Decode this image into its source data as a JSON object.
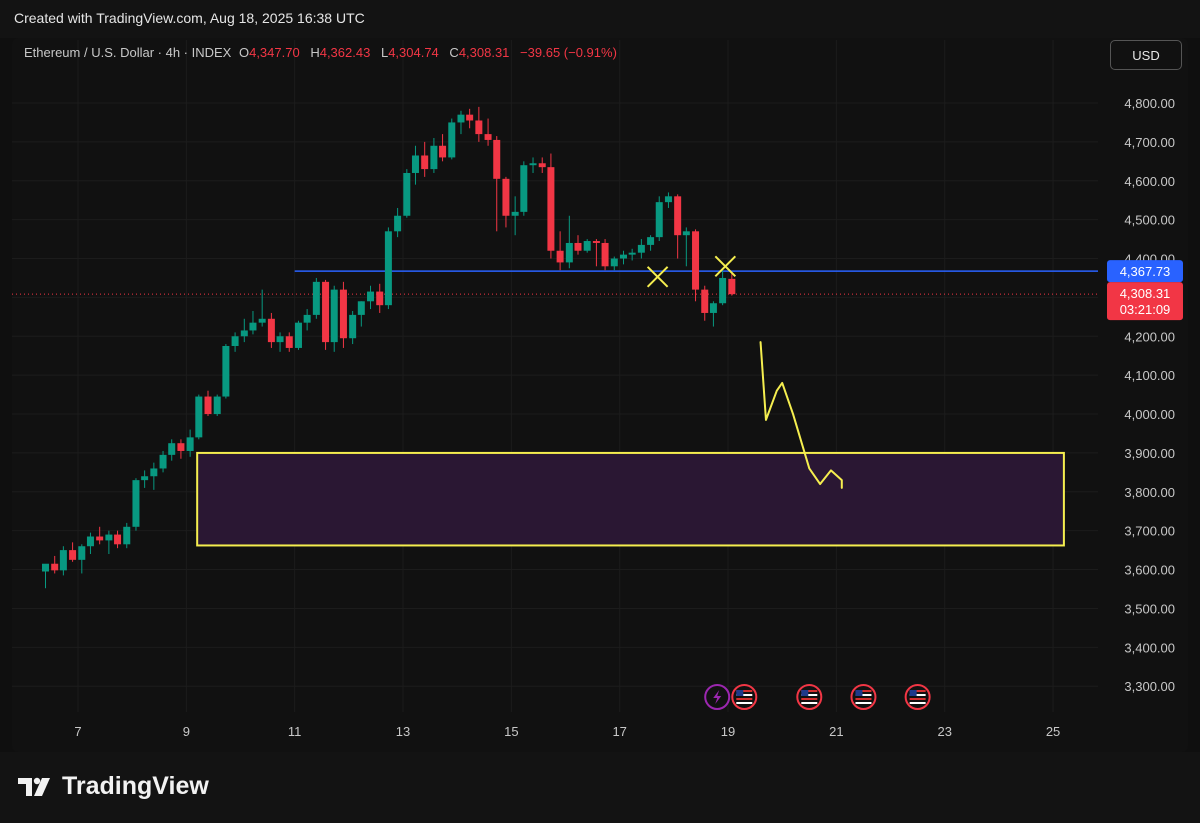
{
  "header": {
    "created_text": "Created with TradingView.com, Aug 18, 2025 16:38 UTC"
  },
  "legend": {
    "symbol": "Ethereum / U.S. Dollar · 4h · INDEX",
    "o_label": "O",
    "o_value": "4,347.70",
    "h_label": "H",
    "h_value": "4,362.43",
    "l_label": "L",
    "l_value": "4,304.74",
    "c_label": "C",
    "c_value": "4,308.31",
    "change": "−39.65 (−0.91%)"
  },
  "currency_button": "USD",
  "footer": {
    "brand": "TradingView"
  },
  "colors": {
    "up": "#089981",
    "down": "#f23645",
    "level_line": "#2962ff",
    "zone_border": "#f5ee4f",
    "zone_fill": "#2a1733",
    "drawing": "#f5ee4f",
    "event_red": "#f23645",
    "event_purple": "#9c27b0"
  },
  "events": [
    {
      "day": 18.8,
      "icon": "lightning-icon"
    },
    {
      "day": 19.3,
      "icon": "us-flag-icon"
    },
    {
      "day": 20.5,
      "icon": "us-flag-icon"
    },
    {
      "day": 21.5,
      "icon": "us-flag-icon"
    },
    {
      "day": 22.5,
      "icon": "us-flag-icon"
    }
  ],
  "chart_data": {
    "type": "candlestick",
    "title": "",
    "xlabel": "",
    "ylabel": "",
    "x_unit": "day of month (Aug 2025)",
    "xlim": [
      6.4,
      25.3
    ],
    "ylim": [
      3240,
      4900
    ],
    "x_ticks": [
      7,
      9,
      11,
      13,
      15,
      17,
      19,
      21,
      23,
      25
    ],
    "x_tick_labels": [
      "7",
      "9",
      "11",
      "13",
      "15",
      "17",
      "19",
      "21",
      "23",
      "25"
    ],
    "y_ticks": [
      3300,
      3400,
      3500,
      3600,
      3700,
      3800,
      3900,
      4000,
      4100,
      4200,
      4300,
      4400,
      4500,
      4600,
      4700,
      4800
    ],
    "y_tick_labels": [
      "3,300.00",
      "3,400.00",
      "3,500.00",
      "3,600.00",
      "3,700.00",
      "3,800.00",
      "3,900.00",
      "4,000.00",
      "4,100.00",
      "4,200.00",
      "4,300.00",
      "4,400.00",
      "4,500.00",
      "4,600.00",
      "4,700.00",
      "4,800.00"
    ],
    "grid": true,
    "level_price": 4367.73,
    "level_label": "4,367.73",
    "last_price": 4308.31,
    "last_price_label": "4,308.31",
    "countdown_label": "03:21:09",
    "zone": {
      "day_start": 9.2,
      "day_end": 25.2,
      "price_low": 3662,
      "price_high": 3900
    },
    "sketch_path": [
      [
        19.6,
        4185
      ],
      [
        19.7,
        3985
      ],
      [
        19.9,
        4060
      ],
      [
        20.0,
        4080
      ],
      [
        20.2,
        4000
      ],
      [
        20.5,
        3860
      ],
      [
        20.7,
        3820
      ],
      [
        20.9,
        3855
      ],
      [
        21.1,
        3830
      ],
      [
        21.1,
        3810
      ]
    ],
    "x_marks": [
      [
        17.7,
        4353
      ],
      [
        18.95,
        4380
      ]
    ],
    "candles": [
      {
        "t": 6.4,
        "o": 3595,
        "h": 3612,
        "l": 3552,
        "c": 3615
      },
      {
        "t": 6.57,
        "o": 3615,
        "h": 3635,
        "l": 3590,
        "c": 3598
      },
      {
        "t": 6.73,
        "o": 3598,
        "h": 3660,
        "l": 3585,
        "c": 3650
      },
      {
        "t": 6.9,
        "o": 3650,
        "h": 3670,
        "l": 3620,
        "c": 3625
      },
      {
        "t": 7.07,
        "o": 3625,
        "h": 3665,
        "l": 3590,
        "c": 3660
      },
      {
        "t": 7.23,
        "o": 3660,
        "h": 3695,
        "l": 3640,
        "c": 3685
      },
      {
        "t": 7.4,
        "o": 3685,
        "h": 3710,
        "l": 3665,
        "c": 3675
      },
      {
        "t": 7.57,
        "o": 3675,
        "h": 3700,
        "l": 3640,
        "c": 3690
      },
      {
        "t": 7.73,
        "o": 3690,
        "h": 3700,
        "l": 3655,
        "c": 3665
      },
      {
        "t": 7.9,
        "o": 3665,
        "h": 3720,
        "l": 3655,
        "c": 3710
      },
      {
        "t": 8.07,
        "o": 3710,
        "h": 3835,
        "l": 3700,
        "c": 3830
      },
      {
        "t": 8.23,
        "o": 3830,
        "h": 3855,
        "l": 3810,
        "c": 3840
      },
      {
        "t": 8.4,
        "o": 3840,
        "h": 3875,
        "l": 3805,
        "c": 3860
      },
      {
        "t": 8.57,
        "o": 3860,
        "h": 3905,
        "l": 3850,
        "c": 3895
      },
      {
        "t": 8.73,
        "o": 3895,
        "h": 3935,
        "l": 3880,
        "c": 3925
      },
      {
        "t": 8.9,
        "o": 3925,
        "h": 3935,
        "l": 3885,
        "c": 3905
      },
      {
        "t": 9.07,
        "o": 3905,
        "h": 3960,
        "l": 3890,
        "c": 3940
      },
      {
        "t": 9.23,
        "o": 3940,
        "h": 4050,
        "l": 3935,
        "c": 4045
      },
      {
        "t": 9.4,
        "o": 4045,
        "h": 4060,
        "l": 3995,
        "c": 4000
      },
      {
        "t": 9.57,
        "o": 4000,
        "h": 4050,
        "l": 3995,
        "c": 4045
      },
      {
        "t": 9.73,
        "o": 4045,
        "h": 4180,
        "l": 4040,
        "c": 4175
      },
      {
        "t": 9.9,
        "o": 4175,
        "h": 4210,
        "l": 4160,
        "c": 4200
      },
      {
        "t": 10.07,
        "o": 4200,
        "h": 4245,
        "l": 4185,
        "c": 4215
      },
      {
        "t": 10.23,
        "o": 4215,
        "h": 4265,
        "l": 4205,
        "c": 4235
      },
      {
        "t": 10.4,
        "o": 4235,
        "h": 4320,
        "l": 4225,
        "c": 4245
      },
      {
        "t": 10.57,
        "o": 4245,
        "h": 4260,
        "l": 4170,
        "c": 4185
      },
      {
        "t": 10.73,
        "o": 4185,
        "h": 4210,
        "l": 4160,
        "c": 4200
      },
      {
        "t": 10.9,
        "o": 4200,
        "h": 4210,
        "l": 4160,
        "c": 4170
      },
      {
        "t": 11.07,
        "o": 4170,
        "h": 4240,
        "l": 4165,
        "c": 4235
      },
      {
        "t": 11.23,
        "o": 4235,
        "h": 4270,
        "l": 4215,
        "c": 4255
      },
      {
        "t": 11.4,
        "o": 4255,
        "h": 4350,
        "l": 4245,
        "c": 4340
      },
      {
        "t": 11.57,
        "o": 4340,
        "h": 4345,
        "l": 4165,
        "c": 4185
      },
      {
        "t": 11.73,
        "o": 4185,
        "h": 4330,
        "l": 4160,
        "c": 4320
      },
      {
        "t": 11.9,
        "o": 4320,
        "h": 4340,
        "l": 4170,
        "c": 4195
      },
      {
        "t": 12.07,
        "o": 4195,
        "h": 4265,
        "l": 4180,
        "c": 4255
      },
      {
        "t": 12.23,
        "o": 4255,
        "h": 4290,
        "l": 4225,
        "c": 4290
      },
      {
        "t": 12.4,
        "o": 4290,
        "h": 4330,
        "l": 4270,
        "c": 4315
      },
      {
        "t": 12.57,
        "o": 4315,
        "h": 4335,
        "l": 4260,
        "c": 4280
      },
      {
        "t": 12.73,
        "o": 4280,
        "h": 4480,
        "l": 4270,
        "c": 4470
      },
      {
        "t": 12.9,
        "o": 4470,
        "h": 4530,
        "l": 4455,
        "c": 4510
      },
      {
        "t": 13.07,
        "o": 4510,
        "h": 4630,
        "l": 4505,
        "c": 4620
      },
      {
        "t": 13.23,
        "o": 4620,
        "h": 4690,
        "l": 4590,
        "c": 4665
      },
      {
        "t": 13.4,
        "o": 4665,
        "h": 4700,
        "l": 4610,
        "c": 4630
      },
      {
        "t": 13.57,
        "o": 4630,
        "h": 4710,
        "l": 4620,
        "c": 4690
      },
      {
        "t": 13.73,
        "o": 4690,
        "h": 4720,
        "l": 4650,
        "c": 4660
      },
      {
        "t": 13.9,
        "o": 4660,
        "h": 4760,
        "l": 4655,
        "c": 4750
      },
      {
        "t": 14.07,
        "o": 4750,
        "h": 4780,
        "l": 4720,
        "c": 4770
      },
      {
        "t": 14.23,
        "o": 4770,
        "h": 4785,
        "l": 4735,
        "c": 4755
      },
      {
        "t": 14.4,
        "o": 4755,
        "h": 4790,
        "l": 4700,
        "c": 4720
      },
      {
        "t": 14.57,
        "o": 4720,
        "h": 4760,
        "l": 4690,
        "c": 4705
      },
      {
        "t": 14.73,
        "o": 4705,
        "h": 4715,
        "l": 4470,
        "c": 4605
      },
      {
        "t": 14.9,
        "o": 4605,
        "h": 4610,
        "l": 4480,
        "c": 4510
      },
      {
        "t": 15.07,
        "o": 4510,
        "h": 4560,
        "l": 4460,
        "c": 4520
      },
      {
        "t": 15.23,
        "o": 4520,
        "h": 4650,
        "l": 4510,
        "c": 4640
      },
      {
        "t": 15.4,
        "o": 4640,
        "h": 4660,
        "l": 4620,
        "c": 4645
      },
      {
        "t": 15.57,
        "o": 4645,
        "h": 4660,
        "l": 4620,
        "c": 4635
      },
      {
        "t": 15.73,
        "o": 4635,
        "h": 4670,
        "l": 4400,
        "c": 4420
      },
      {
        "t": 15.9,
        "o": 4420,
        "h": 4470,
        "l": 4370,
        "c": 4390
      },
      {
        "t": 16.07,
        "o": 4390,
        "h": 4510,
        "l": 4375,
        "c": 4440
      },
      {
        "t": 16.23,
        "o": 4440,
        "h": 4460,
        "l": 4410,
        "c": 4420
      },
      {
        "t": 16.4,
        "o": 4420,
        "h": 4450,
        "l": 4415,
        "c": 4445
      },
      {
        "t": 16.57,
        "o": 4445,
        "h": 4450,
        "l": 4380,
        "c": 4440
      },
      {
        "t": 16.73,
        "o": 4440,
        "h": 4450,
        "l": 4370,
        "c": 4380
      },
      {
        "t": 16.9,
        "o": 4380,
        "h": 4405,
        "l": 4370,
        "c": 4400
      },
      {
        "t": 17.07,
        "o": 4400,
        "h": 4420,
        "l": 4385,
        "c": 4410
      },
      {
        "t": 17.23,
        "o": 4410,
        "h": 4425,
        "l": 4395,
        "c": 4415
      },
      {
        "t": 17.4,
        "o": 4415,
        "h": 4450,
        "l": 4400,
        "c": 4435
      },
      {
        "t": 17.57,
        "o": 4435,
        "h": 4460,
        "l": 4420,
        "c": 4455
      },
      {
        "t": 17.73,
        "o": 4455,
        "h": 4560,
        "l": 4445,
        "c": 4545
      },
      {
        "t": 17.9,
        "o": 4545,
        "h": 4570,
        "l": 4530,
        "c": 4560
      },
      {
        "t": 18.07,
        "o": 4560,
        "h": 4565,
        "l": 4400,
        "c": 4460
      },
      {
        "t": 18.23,
        "o": 4460,
        "h": 4480,
        "l": 4380,
        "c": 4470
      },
      {
        "t": 18.4,
        "o": 4470,
        "h": 4475,
        "l": 4290,
        "c": 4320
      },
      {
        "t": 18.57,
        "o": 4320,
        "h": 4330,
        "l": 4240,
        "c": 4260
      },
      {
        "t": 18.73,
        "o": 4260,
        "h": 4290,
        "l": 4225,
        "c": 4285
      },
      {
        "t": 18.9,
        "o": 4285,
        "h": 4370,
        "l": 4280,
        "c": 4350
      },
      {
        "t": 19.07,
        "o": 4347.7,
        "h": 4362.43,
        "l": 4304.74,
        "c": 4308.31
      }
    ]
  }
}
